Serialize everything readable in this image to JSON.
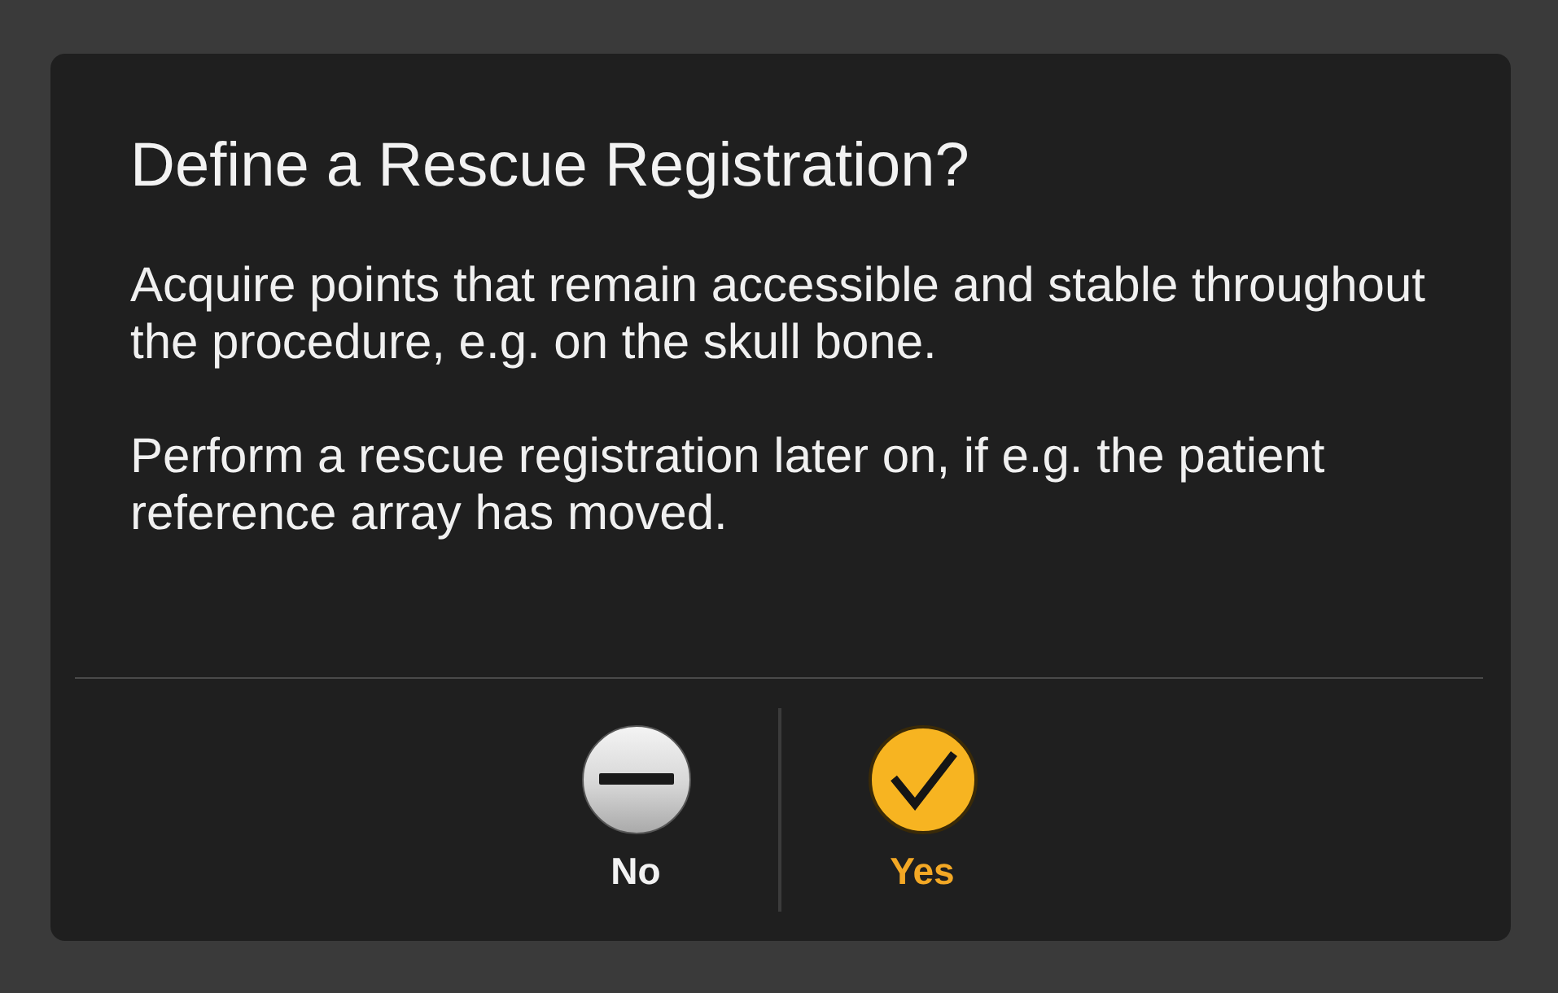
{
  "dialog": {
    "title": "Define a Rescue Registration?",
    "paragraphs": [
      "Acquire points that remain accessible and stable throughout the procedure, e.g. on the skull bone.",
      "Perform a rescue registration later on, if e.g. the patient reference array has moved."
    ]
  },
  "buttons": [
    {
      "kind": "negative",
      "label": "No"
    },
    {
      "kind": "positive",
      "label": "Yes"
    }
  ]
}
